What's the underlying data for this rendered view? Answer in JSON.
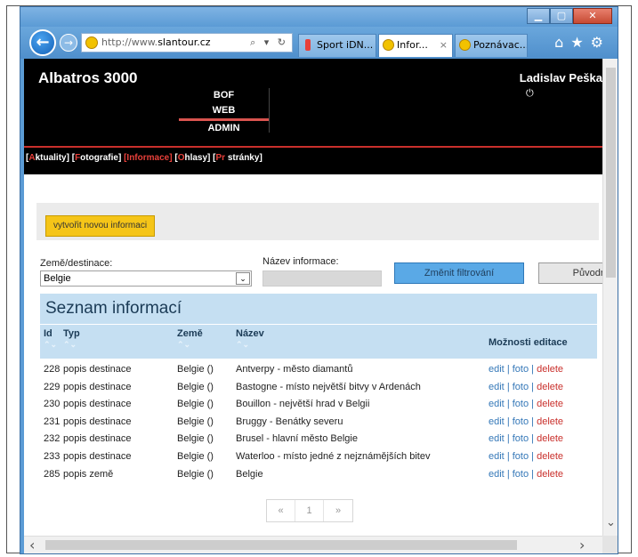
{
  "browser": {
    "address": "http://www.",
    "address_domain": "slantour.cz",
    "address_icons": "⌕ ▾ ↻",
    "tabs": [
      {
        "label": "Sport iDN...",
        "icon": "sport-icon"
      },
      {
        "label": "Infor...",
        "icon": "sun-icon"
      },
      {
        "label": "Poznávac...",
        "icon": "sun-icon"
      }
    ],
    "tab_close": "×"
  },
  "header": {
    "brand": "Albatros 3000",
    "user_name": "Ladislav Peška",
    "sys_nav": [
      "BOF",
      "WEB",
      "ADMIN"
    ]
  },
  "submenu": {
    "items": [
      {
        "prefix": "[",
        "first": "A",
        "rest": "ktuality",
        "suffix": "]"
      },
      {
        "prefix": "[",
        "first": "F",
        "rest": "otografie",
        "suffix": "]"
      },
      {
        "prefix": "[",
        "first": "I",
        "rest": "nformace",
        "suffix": "]"
      },
      {
        "prefix": "[",
        "first": "O",
        "rest": "hlasy",
        "suffix": "]"
      },
      {
        "prefix": "[",
        "first": "Pr",
        "rest": " stránky",
        "suffix": "]"
      }
    ]
  },
  "actions": {
    "create_label": "vytvořit novou informaci"
  },
  "filter": {
    "country_label": "Země/destinace:",
    "country_value": "Belgie",
    "name_label": "Název informace:",
    "name_value": "",
    "apply_label": "Změnit filtrování",
    "reset_label": "Původní"
  },
  "list": {
    "title": "Seznam informací",
    "columns": {
      "id": "Id",
      "type": "Typ",
      "country": "Země",
      "name": "Název",
      "edit": "Možnosti editace"
    },
    "sort_glyph": "⌃⌄",
    "rows": [
      {
        "id": "228",
        "type": "popis destinace",
        "country": "Belgie ()",
        "name": "Antverpy - město diamantů"
      },
      {
        "id": "229",
        "type": "popis destinace",
        "country": "Belgie ()",
        "name": "Bastogne - místo největší bitvy v Ardenách"
      },
      {
        "id": "230",
        "type": "popis destinace",
        "country": "Belgie ()",
        "name": "Bouillon - největší hrad v Belgii"
      },
      {
        "id": "231",
        "type": "popis destinace",
        "country": "Belgie ()",
        "name": "Bruggy - Benátky severu"
      },
      {
        "id": "232",
        "type": "popis destinace",
        "country": "Belgie ()",
        "name": "Brusel - hlavní město Belgie"
      },
      {
        "id": "233",
        "type": "popis destinace",
        "country": "Belgie ()",
        "name": "Waterloo - místo jedné z nejznámějších bitev"
      },
      {
        "id": "285",
        "type": "popis země",
        "country": "Belgie ()",
        "name": "Belgie"
      }
    ],
    "edit_link": "edit",
    "photo_link": "foto",
    "delete_link": "delete",
    "sep": "|"
  },
  "pager": {
    "prev": "«",
    "page": "1",
    "next": "»"
  },
  "colors": {
    "accent_red": "#c9302c",
    "link_blue": "#3578b8",
    "header_bg": "#000000",
    "table_head": "#c5dff2",
    "create_btn": "#f5c518"
  }
}
